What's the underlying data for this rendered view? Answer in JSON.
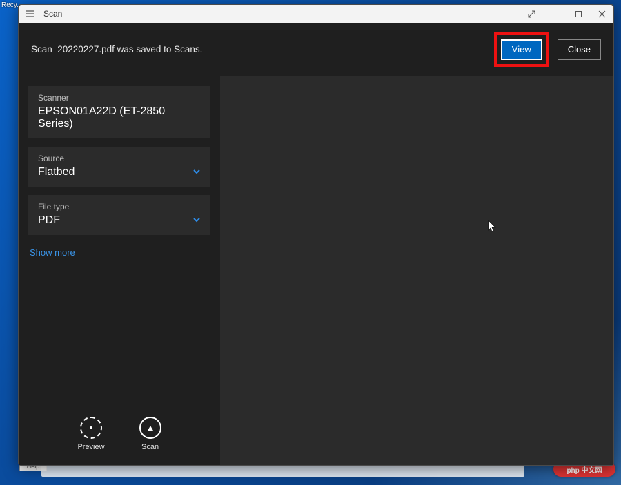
{
  "desktop": {
    "recycle_label": "Recy...",
    "help_label": "Help",
    "badge": "php 中文网"
  },
  "titlebar": {
    "title": "Scan"
  },
  "notify": {
    "message": "Scan_20220227.pdf was saved to Scans.",
    "view_label": "View",
    "close_label": "Close"
  },
  "settings": {
    "scanner": {
      "label": "Scanner",
      "value": "EPSON01A22D (ET-2850 Series)"
    },
    "source": {
      "label": "Source",
      "value": "Flatbed"
    },
    "filetype": {
      "label": "File type",
      "value": "PDF"
    },
    "show_more": "Show more"
  },
  "actions": {
    "preview": "Preview",
    "scan": "Scan"
  }
}
